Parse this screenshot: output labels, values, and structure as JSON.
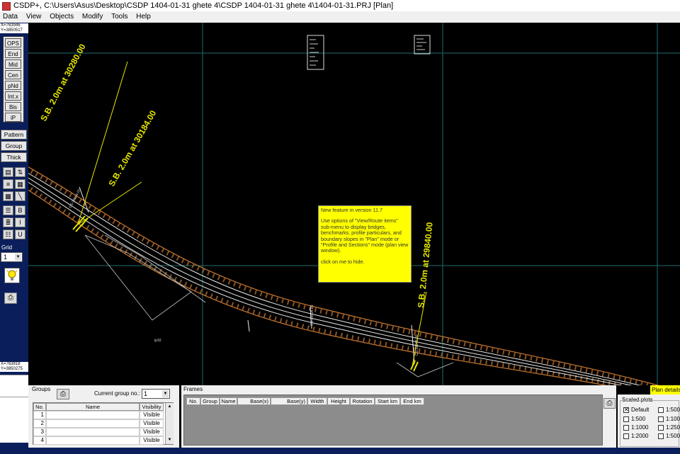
{
  "window": {
    "title": "CSDP+, C:\\Users\\Asus\\Desktop\\CSDP 1404-01-31 ghete 4\\CSDP 1404-01-31 ghete 4\\1404-01-31.PRJ [Plan]"
  },
  "menu": [
    "Data",
    "View",
    "Objects",
    "Modify",
    "Tools",
    "Help"
  ],
  "left": {
    "coord_top_x": "X=763946",
    "coord_top_y": "Y=3850517",
    "snap_buttons": [
      "OPS",
      "End",
      "Mid",
      "Cen",
      "pNd",
      "Int.x",
      "Bis",
      "iP"
    ],
    "pattern": "Pattern",
    "group": "Group",
    "thick": "Thick",
    "grid_label": "Grid",
    "grid_value": "1",
    "coord_bot_x": "X=763818",
    "coord_bot_y": "Y=3850275"
  },
  "canvas": {
    "sb_labels": [
      "S.B. 2.0m  at  30280.00",
      "S.B. 2.0m  at  30184.00",
      "S.B. 2.0m  at  29840.00"
    ],
    "ip_label": "ip10"
  },
  "tooltip": {
    "line1": "New feature in version 11.7",
    "line2": "Use options of \"View/Route items\" sub-menu to display bridges, benchmarks, profile particulars, and boundary slopes in \"Plan\" mode or \"Profile and Sections\" mode (plan view window).",
    "line3": "click on me to hide."
  },
  "plan_details": "Plan details",
  "groups": {
    "title": "Groups",
    "current_label": "Current group no.:",
    "current_value": "1",
    "columns": [
      "No.",
      "Name",
      "Visibility"
    ],
    "rows": [
      {
        "no": "1",
        "name": "",
        "vis": "Visible"
      },
      {
        "no": "2",
        "name": "",
        "vis": "Visible"
      },
      {
        "no": "3",
        "name": "",
        "vis": "Visible"
      },
      {
        "no": "4",
        "name": "",
        "vis": "Visible"
      }
    ]
  },
  "frames": {
    "title": "Frames",
    "columns": [
      "No.",
      "Group",
      "Name",
      "Base(x)",
      "Base(y)",
      "Width",
      "Height",
      "Rotation",
      "Start km",
      "End km"
    ]
  },
  "plots": {
    "title": "Scaled plots",
    "items": [
      {
        "label": "Default",
        "checked": true
      },
      {
        "label": "1:500",
        "checked": false
      },
      {
        "label": "1:500",
        "checked": false
      },
      {
        "label": "1:1000",
        "checked": false
      },
      {
        "label": "1:1000",
        "checked": false
      },
      {
        "label": "1:250",
        "checked": false
      },
      {
        "label": "1:2000",
        "checked": false
      },
      {
        "label": "1:500",
        "checked": false
      }
    ]
  },
  "colors": {
    "road_orange": "#c87830",
    "label_yellow": "#e6e600",
    "panel_blue": "#0a1e5c",
    "grid_cyan": "#1e6e6e"
  }
}
